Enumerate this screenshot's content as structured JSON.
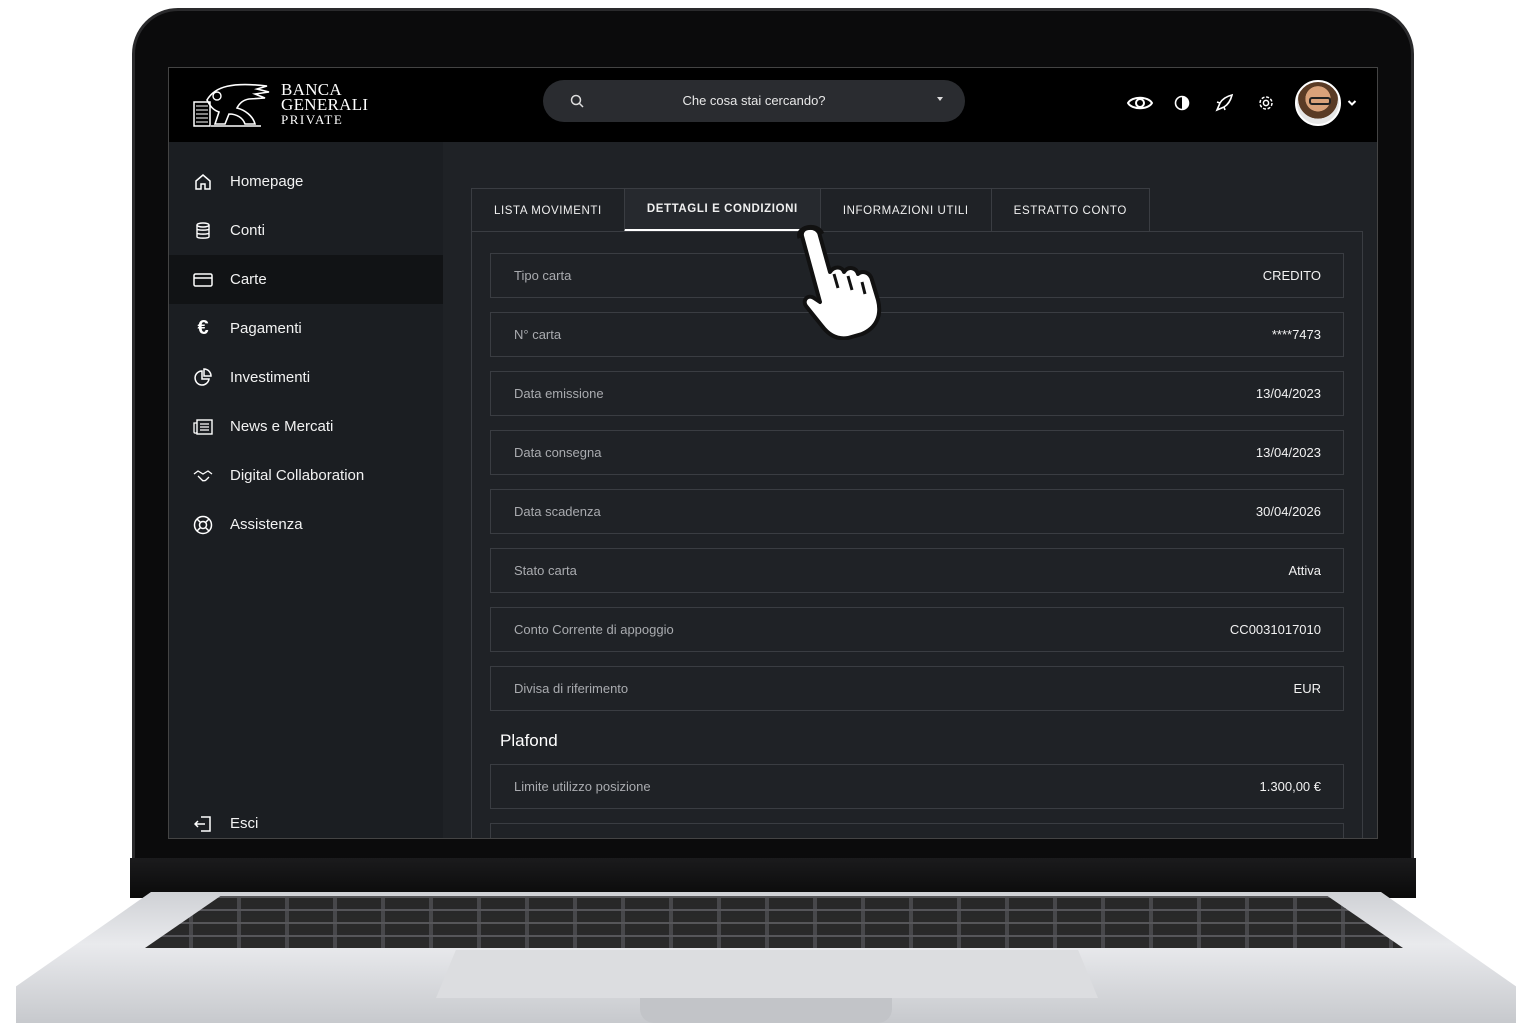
{
  "brand": {
    "line1": "BANCA",
    "line2": "GENERALI",
    "line3": "PRIVATE"
  },
  "search": {
    "placeholder": "Che cosa stai cercando?"
  },
  "sidebar": {
    "items": [
      {
        "label": "Homepage",
        "icon": "home-icon"
      },
      {
        "label": "Conti",
        "icon": "coins-icon"
      },
      {
        "label": "Carte",
        "icon": "card-icon",
        "active": true
      },
      {
        "label": "Pagamenti",
        "icon": "euro-icon"
      },
      {
        "label": "Investimenti",
        "icon": "pie-chart-icon"
      },
      {
        "label": "News e Mercati",
        "icon": "newspaper-icon"
      },
      {
        "label": "Digital Collaboration",
        "icon": "handshake-icon"
      },
      {
        "label": "Assistenza",
        "icon": "lifebuoy-icon"
      }
    ],
    "logout": {
      "label": "Esci",
      "icon": "logout-icon"
    }
  },
  "tabs": [
    {
      "label": "LISTA MOVIMENTI"
    },
    {
      "label": "DETTAGLI E CONDIZIONI",
      "active": true
    },
    {
      "label": "INFORMAZIONI UTILI"
    },
    {
      "label": "ESTRATTO CONTO"
    }
  ],
  "details": [
    {
      "label": "Tipo carta",
      "value": "CREDITO"
    },
    {
      "label": "N° carta",
      "value": "****7473"
    },
    {
      "label": "Data emissione",
      "value": "13/04/2023"
    },
    {
      "label": "Data consegna",
      "value": "13/04/2023"
    },
    {
      "label": "Data scadenza",
      "value": "30/04/2026"
    },
    {
      "label": "Stato carta",
      "value": "Attiva"
    },
    {
      "label": "Conto Corrente di appoggio",
      "value": "CC0031017010"
    },
    {
      "label": "Divisa di riferimento",
      "value": "EUR"
    }
  ],
  "plafond": {
    "title": "Plafond",
    "rows": [
      {
        "label": "Limite utilizzo posizione",
        "value": "1.300,00 €"
      }
    ]
  },
  "colors": {
    "background": "#1f2226",
    "topbar": "#000000",
    "sidebar": "#1b1e22",
    "accent": "#ffffff"
  }
}
